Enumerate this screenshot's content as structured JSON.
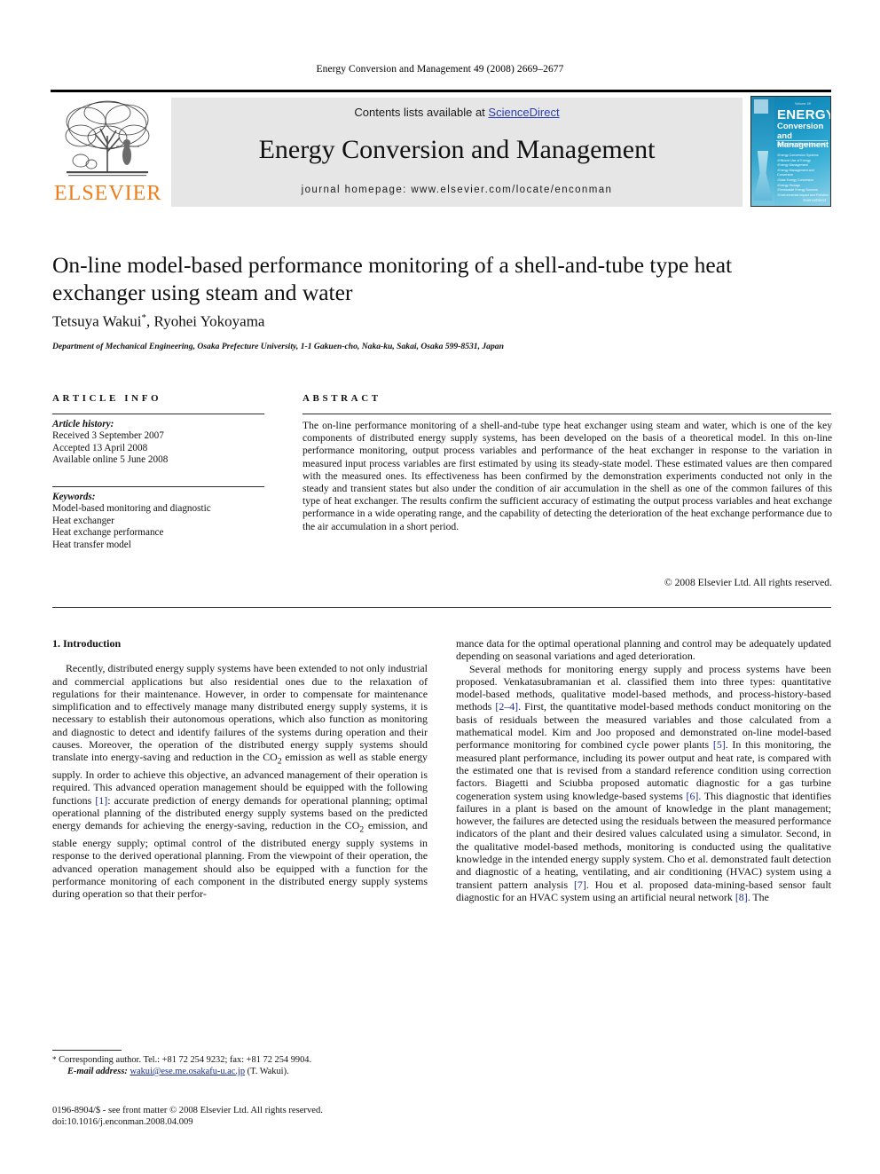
{
  "running_head": "Energy Conversion and Management 49 (2008) 2669–2677",
  "masthead": {
    "contents_prefix": "Contents lists available at ",
    "sciencedirect": "ScienceDirect",
    "journal_title": "Energy Conversion and Management",
    "homepage": "journal homepage: www.elsevier.com/locate/enconman",
    "publisher": "ELSEVIER",
    "accent_orange": "#EF7D18",
    "link_blue": "#2A3FB5",
    "band_gray": "#E6E6E6"
  },
  "cover": {
    "tiny_top": "Volume 49",
    "title_main": "ENERGY",
    "title_sub_line1": "Conversion and",
    "title_sub_line2": "Management",
    "tagline": "an international journal",
    "topics": [
      "Energy Conversion Systems",
      "Efficient Use of Energy",
      "Energy Management",
      "Energy Management and Conversion",
      "Solar Energy Conversion",
      "Energy Storage",
      "Renewable Energy Sources",
      "Environmental Impact and Pollution"
    ],
    "footer": "ScienceDirect"
  },
  "article": {
    "title": "On-line model-based performance monitoring of a shell-and-tube type heat exchanger using steam and water",
    "authors": "Tetsuya Wakui",
    "authors_marker": "*",
    "authors_rest": ", Ryohei Yokoyama",
    "affiliation": "Department of Mechanical Engineering, Osaka Prefecture University, 1-1 Gakuen-cho, Naka-ku, Sakai, Osaka 599-8531, Japan"
  },
  "info": {
    "heading": "ARTICLE INFO",
    "history_label": "Article history:",
    "history": [
      "Received 3 September 2007",
      "Accepted 13 April 2008",
      "Available online 5 June 2008"
    ],
    "keywords_label": "Keywords:",
    "keywords": [
      "Model-based monitoring and diagnostic",
      "Heat exchanger",
      "Heat exchange performance",
      "Heat transfer model"
    ]
  },
  "abstract": {
    "heading": "ABSTRACT",
    "text": "The on-line performance monitoring of a shell-and-tube type heat exchanger using steam and water, which is one of the key components of distributed energy supply systems, has been developed on the basis of a theoretical model. In this on-line performance monitoring, output process variables and performance of the heat exchanger in response to the variation in measured input process variables are first estimated by using its steady-state model. These estimated values are then compared with the measured ones. Its effectiveness has been confirmed by the demonstration experiments conducted not only in the steady and transient states but also under the condition of air accumulation in the shell as one of the common failures of this type of heat exchanger. The results confirm the sufficient accuracy of estimating the output process variables and heat exchange performance in a wide operating range, and the capability of detecting the deterioration of the heat exchange performance due to the air accumulation in a short period.",
    "copyright": "© 2008 Elsevier Ltd. All rights reserved."
  },
  "body": {
    "section_heading": "1. Introduction",
    "left_paragraph_1": "Recently, distributed energy supply systems have been extended to not only industrial and commercial applications but also residential ones due to the relaxation of regulations for their maintenance. However, in order to compensate for maintenance simplification and to effectively manage many distributed energy supply systems, it is necessary to establish their autonomous operations, which also function as monitoring and diagnostic to detect and identify failures of the systems during operation and their causes. Moreover, the operation of the distributed energy supply systems should translate into energy-saving and reduction in the CO",
    "left_p1_sub": "2",
    "left_p1_b": " emission as well as stable energy supply. In order to achieve this objective, an advanced management of their operation is required. This advanced operation management should be equipped with the following functions ",
    "left_ref_1": "[1]",
    "left_p1_c": ": accurate prediction of energy demands for operational planning; optimal operational planning of the distributed energy supply systems based on the predicted energy demands for achieving the energy-saving, reduction in the CO",
    "left_p1_d": " emission, and stable energy supply; optimal control of the distributed energy supply systems in response to the derived operational planning. From the viewpoint of their operation, the advanced operation management should also be equipped with a function for the performance monitoring of each component in the distributed energy supply systems during operation so that their perfor-",
    "right_paragraph_1": "mance data for the optimal operational planning and control may be adequately updated depending on seasonal variations and aged deterioration.",
    "right_p2_a": "Several methods for monitoring energy supply and process systems have been proposed. Venkatasubramanian et al. classified them into three types: quantitative model-based methods, qualitative model-based methods, and process-history-based methods ",
    "right_ref_2_4": "[2–4]",
    "right_p2_b": ". First, the quantitative model-based methods conduct monitoring on the basis of residuals between the measured variables and those calculated from a mathematical model. Kim and Joo proposed and demonstrated on-line model-based performance monitoring for combined cycle power plants ",
    "right_ref_5": "[5]",
    "right_p2_c": ". In this monitoring, the measured plant performance, including its power output and heat rate, is compared with the estimated one that is revised from a standard reference condition using correction factors. Biagetti and Sciubba proposed automatic diagnostic for a gas turbine cogeneration system using knowledge-based systems ",
    "right_ref_6": "[6]",
    "right_p2_d": ". This diagnostic that identifies failures in a plant is based on the amount of knowledge in the plant management; however, the failures are detected using the residuals between the measured performance indicators of the plant and their desired values calculated using a simulator. Second, in the qualitative model-based methods, monitoring is conducted using the qualitative knowledge in the intended energy supply system. Cho et al. demonstrated fault detection and diagnostic of a heating, ventilating, and air conditioning (HVAC) system using a transient pattern analysis ",
    "right_ref_7": "[7]",
    "right_p2_e": ". Hou et al. proposed data-mining-based sensor fault diagnostic for an HVAC system using an artificial neural network ",
    "right_ref_8": "[8]",
    "right_p2_f": ". The"
  },
  "footnote": {
    "marker": "*",
    "line1": "Corresponding author. Tel.: +81 72 254 9232; fax: +81 72 254 9904.",
    "email_label": "E-mail address:",
    "email": "wakui@ese.me.osakafu-u.ac.jp",
    "email_owner": "(T. Wakui)."
  },
  "imprint": {
    "line1": "0196-8904/$ - see front matter © 2008 Elsevier Ltd. All rights reserved.",
    "line2": "doi:10.1016/j.enconman.2008.04.009"
  }
}
